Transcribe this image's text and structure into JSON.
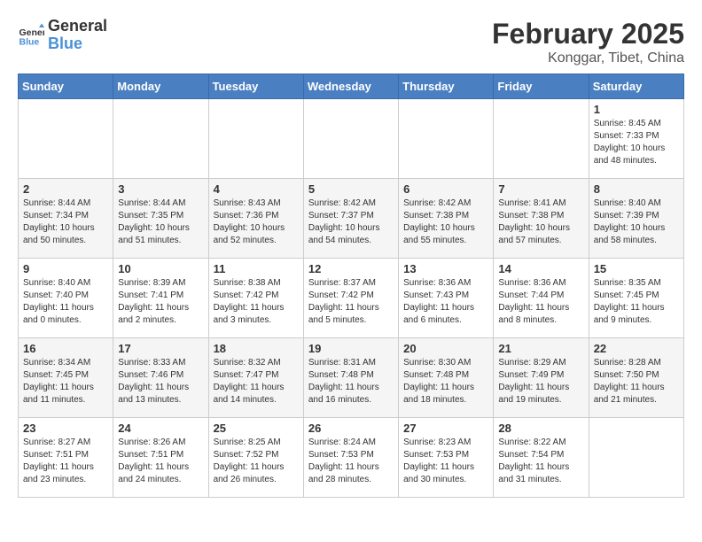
{
  "header": {
    "logo_general": "General",
    "logo_blue": "Blue",
    "month_title": "February 2025",
    "subtitle": "Konggar, Tibet, China"
  },
  "days_of_week": [
    "Sunday",
    "Monday",
    "Tuesday",
    "Wednesday",
    "Thursday",
    "Friday",
    "Saturday"
  ],
  "weeks": [
    [
      {
        "day": "",
        "info": ""
      },
      {
        "day": "",
        "info": ""
      },
      {
        "day": "",
        "info": ""
      },
      {
        "day": "",
        "info": ""
      },
      {
        "day": "",
        "info": ""
      },
      {
        "day": "",
        "info": ""
      },
      {
        "day": "1",
        "info": "Sunrise: 8:45 AM\nSunset: 7:33 PM\nDaylight: 10 hours\nand 48 minutes."
      }
    ],
    [
      {
        "day": "2",
        "info": "Sunrise: 8:44 AM\nSunset: 7:34 PM\nDaylight: 10 hours\nand 50 minutes."
      },
      {
        "day": "3",
        "info": "Sunrise: 8:44 AM\nSunset: 7:35 PM\nDaylight: 10 hours\nand 51 minutes."
      },
      {
        "day": "4",
        "info": "Sunrise: 8:43 AM\nSunset: 7:36 PM\nDaylight: 10 hours\nand 52 minutes."
      },
      {
        "day": "5",
        "info": "Sunrise: 8:42 AM\nSunset: 7:37 PM\nDaylight: 10 hours\nand 54 minutes."
      },
      {
        "day": "6",
        "info": "Sunrise: 8:42 AM\nSunset: 7:38 PM\nDaylight: 10 hours\nand 55 minutes."
      },
      {
        "day": "7",
        "info": "Sunrise: 8:41 AM\nSunset: 7:38 PM\nDaylight: 10 hours\nand 57 minutes."
      },
      {
        "day": "8",
        "info": "Sunrise: 8:40 AM\nSunset: 7:39 PM\nDaylight: 10 hours\nand 58 minutes."
      }
    ],
    [
      {
        "day": "9",
        "info": "Sunrise: 8:40 AM\nSunset: 7:40 PM\nDaylight: 11 hours\nand 0 minutes."
      },
      {
        "day": "10",
        "info": "Sunrise: 8:39 AM\nSunset: 7:41 PM\nDaylight: 11 hours\nand 2 minutes."
      },
      {
        "day": "11",
        "info": "Sunrise: 8:38 AM\nSunset: 7:42 PM\nDaylight: 11 hours\nand 3 minutes."
      },
      {
        "day": "12",
        "info": "Sunrise: 8:37 AM\nSunset: 7:42 PM\nDaylight: 11 hours\nand 5 minutes."
      },
      {
        "day": "13",
        "info": "Sunrise: 8:36 AM\nSunset: 7:43 PM\nDaylight: 11 hours\nand 6 minutes."
      },
      {
        "day": "14",
        "info": "Sunrise: 8:36 AM\nSunset: 7:44 PM\nDaylight: 11 hours\nand 8 minutes."
      },
      {
        "day": "15",
        "info": "Sunrise: 8:35 AM\nSunset: 7:45 PM\nDaylight: 11 hours\nand 9 minutes."
      }
    ],
    [
      {
        "day": "16",
        "info": "Sunrise: 8:34 AM\nSunset: 7:45 PM\nDaylight: 11 hours\nand 11 minutes."
      },
      {
        "day": "17",
        "info": "Sunrise: 8:33 AM\nSunset: 7:46 PM\nDaylight: 11 hours\nand 13 minutes."
      },
      {
        "day": "18",
        "info": "Sunrise: 8:32 AM\nSunset: 7:47 PM\nDaylight: 11 hours\nand 14 minutes."
      },
      {
        "day": "19",
        "info": "Sunrise: 8:31 AM\nSunset: 7:48 PM\nDaylight: 11 hours\nand 16 minutes."
      },
      {
        "day": "20",
        "info": "Sunrise: 8:30 AM\nSunset: 7:48 PM\nDaylight: 11 hours\nand 18 minutes."
      },
      {
        "day": "21",
        "info": "Sunrise: 8:29 AM\nSunset: 7:49 PM\nDaylight: 11 hours\nand 19 minutes."
      },
      {
        "day": "22",
        "info": "Sunrise: 8:28 AM\nSunset: 7:50 PM\nDaylight: 11 hours\nand 21 minutes."
      }
    ],
    [
      {
        "day": "23",
        "info": "Sunrise: 8:27 AM\nSunset: 7:51 PM\nDaylight: 11 hours\nand 23 minutes."
      },
      {
        "day": "24",
        "info": "Sunrise: 8:26 AM\nSunset: 7:51 PM\nDaylight: 11 hours\nand 24 minutes."
      },
      {
        "day": "25",
        "info": "Sunrise: 8:25 AM\nSunset: 7:52 PM\nDaylight: 11 hours\nand 26 minutes."
      },
      {
        "day": "26",
        "info": "Sunrise: 8:24 AM\nSunset: 7:53 PM\nDaylight: 11 hours\nand 28 minutes."
      },
      {
        "day": "27",
        "info": "Sunrise: 8:23 AM\nSunset: 7:53 PM\nDaylight: 11 hours\nand 30 minutes."
      },
      {
        "day": "28",
        "info": "Sunrise: 8:22 AM\nSunset: 7:54 PM\nDaylight: 11 hours\nand 31 minutes."
      },
      {
        "day": "",
        "info": ""
      }
    ]
  ]
}
